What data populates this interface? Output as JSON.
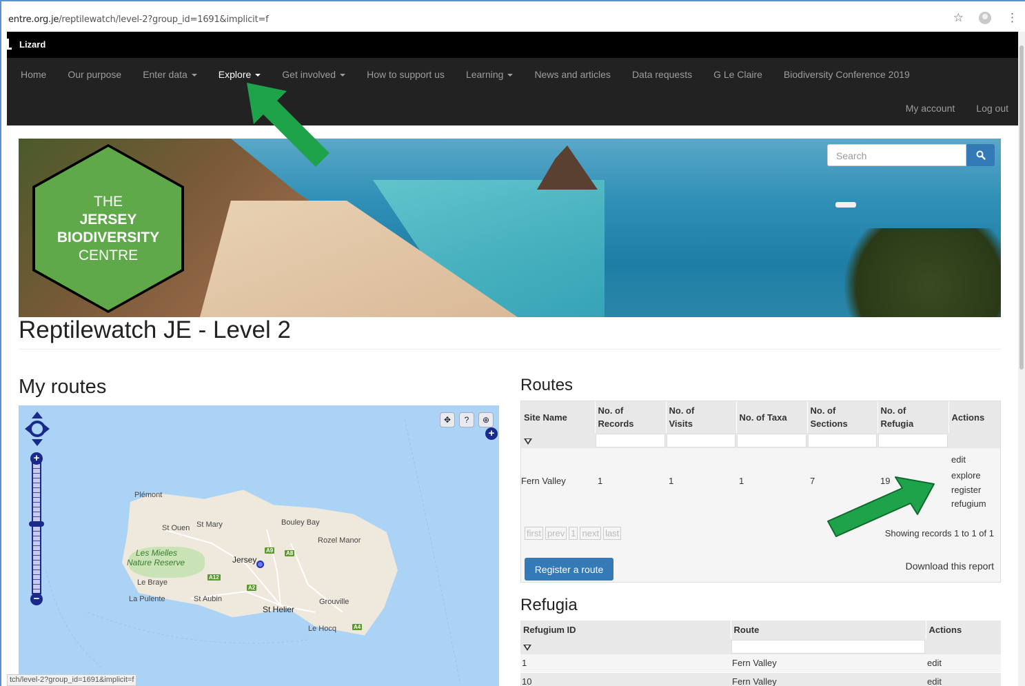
{
  "browser": {
    "url_host": "centre.org.je",
    "url_path": "/reptilewatch/level-2?group_id=1691&implicit=f",
    "url_prefix_clipped": "entre.org.je",
    "status_url": "tch/level-2?group_id=1691&implicit=f"
  },
  "topbar": {
    "brand": "Lizard"
  },
  "nav": {
    "items": [
      {
        "label": "Home",
        "dropdown": false
      },
      {
        "label": "Our purpose",
        "dropdown": false
      },
      {
        "label": "Enter data",
        "dropdown": true
      },
      {
        "label": "Explore",
        "dropdown": true,
        "active": true
      },
      {
        "label": "Get involved",
        "dropdown": true
      },
      {
        "label": "How to support us",
        "dropdown": false
      },
      {
        "label": "Learning",
        "dropdown": true
      },
      {
        "label": "News and articles",
        "dropdown": false
      },
      {
        "label": "Data requests",
        "dropdown": false
      },
      {
        "label": "G Le Claire",
        "dropdown": false
      },
      {
        "label": "Biodiversity Conference 2019",
        "dropdown": false
      }
    ],
    "right": [
      {
        "label": "My account"
      },
      {
        "label": "Log out"
      }
    ]
  },
  "logo": {
    "line1": "THE",
    "line2": "JERSEY",
    "line3": "BIODIVERSITY",
    "line4": "CENTRE"
  },
  "search": {
    "placeholder": "Search"
  },
  "page": {
    "title": "Reptilewatch JE - Level 2",
    "my_routes_heading": "My routes",
    "routes_heading": "Routes",
    "refugia_heading": "Refugia"
  },
  "map": {
    "labels": {
      "plemont": "Plémont",
      "st_ouen": "St Ouen",
      "st_mary": "St Mary",
      "bouley_bay": "Bouley Bay",
      "rozel_manor": "Rozel Manor",
      "les_mielles": "Les Mielles",
      "nature_reserve": "Nature Reserve",
      "jersey": "Jersey",
      "le_braye": "Le Braye",
      "la_pulente": "La Pulente",
      "st_aubin": "St Aubin",
      "st_helier": "St Helier",
      "grouville": "Grouville",
      "le_hocq": "Le Hocq"
    },
    "roads": {
      "a9": "A9",
      "a8": "A8",
      "a12": "A12",
      "a2": "A2",
      "a4": "A4"
    }
  },
  "routes_table": {
    "columns": [
      "Site Name",
      "No. of Records",
      "No. of Visits",
      "No. of Taxa",
      "No. of Sections",
      "No. of Refugia",
      "Actions"
    ],
    "column_lines": [
      [
        "Site Name"
      ],
      [
        "No. of",
        "Records"
      ],
      [
        "No. of",
        "Visits"
      ],
      [
        "No. of Taxa"
      ],
      [
        "No. of",
        "Sections"
      ],
      [
        "No. of",
        "Refugia"
      ],
      [
        "Actions"
      ]
    ],
    "rows": [
      {
        "site_name": "Fern Valley",
        "records": "1",
        "visits": "1",
        "taxa": "1",
        "sections": "7",
        "refugia": "19",
        "actions": [
          "edit",
          "explore",
          "register",
          "refugium"
        ]
      }
    ],
    "pager": [
      "first",
      "prev",
      "1",
      "next",
      "last"
    ],
    "showing": "Showing records 1 to 1 of 1",
    "register_button": "Register a route",
    "download": "Download this report"
  },
  "refugia_table": {
    "columns": [
      "Refugium ID",
      "Route",
      "Actions"
    ],
    "rows": [
      {
        "id": "1",
        "route": "Fern Valley",
        "action": "edit"
      },
      {
        "id": "10",
        "route": "Fern Valley",
        "action": "edit"
      }
    ]
  },
  "colors": {
    "nav_bg": "#222222",
    "topbar_bg": "#000000",
    "primary_button": "#337ab7",
    "logo_green": "#5fa94a",
    "annotation_arrow": "#1fa34a",
    "map_sea": "#abd3f5"
  }
}
